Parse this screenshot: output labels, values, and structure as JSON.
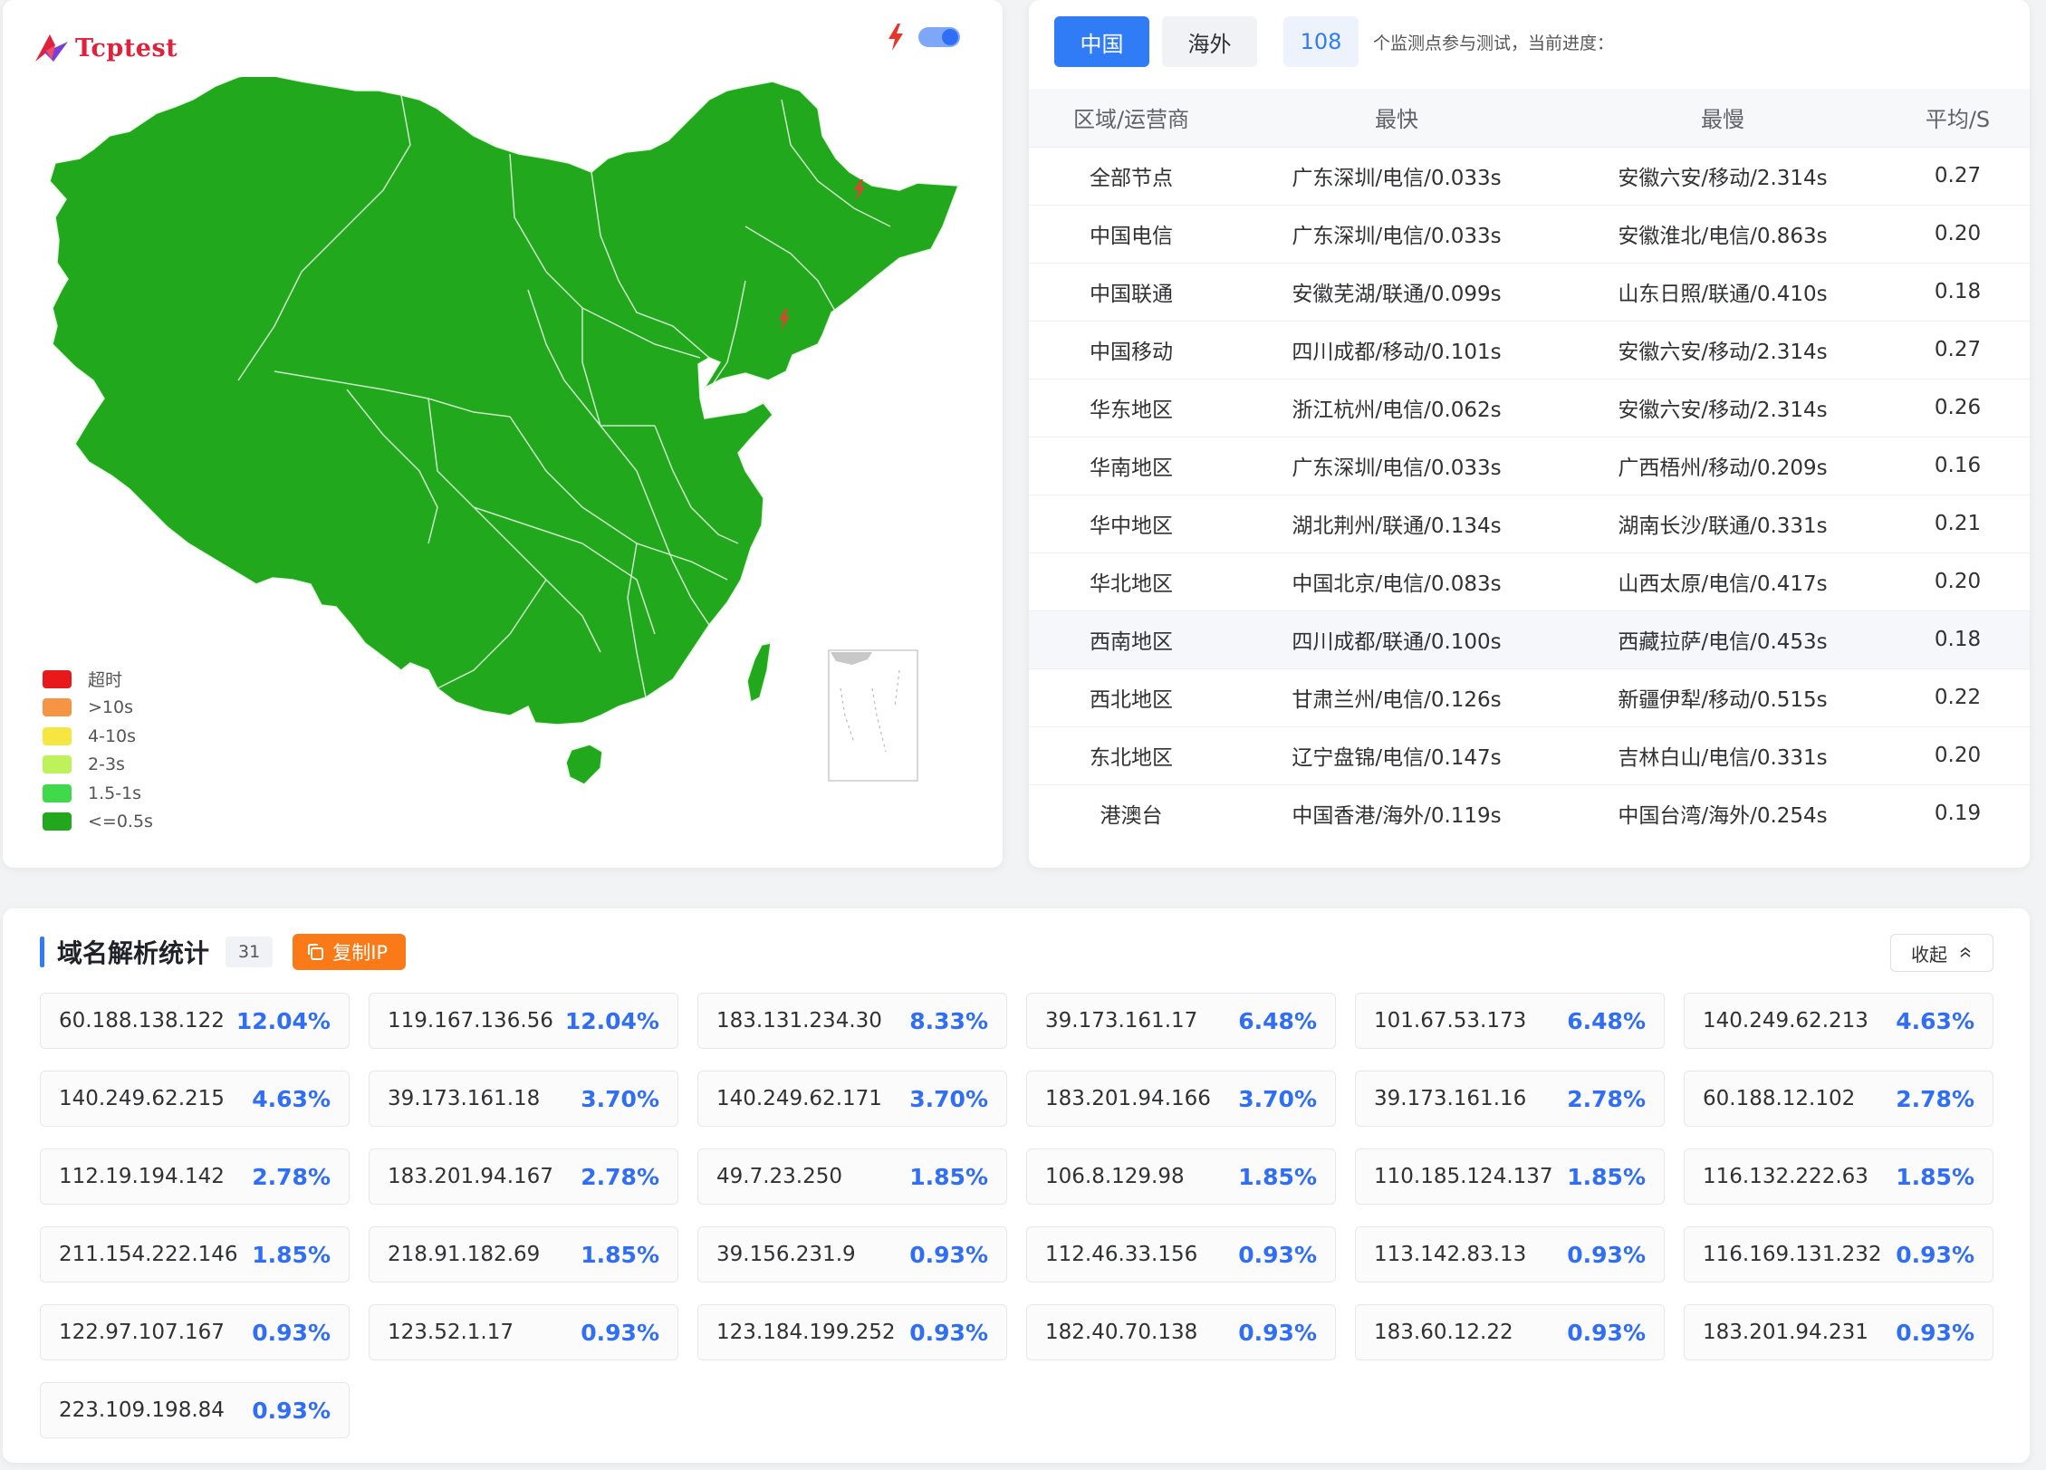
{
  "brand": {
    "name": "Tcptest"
  },
  "map": {
    "legend": [
      {
        "label": "超时",
        "color": "#e8191b"
      },
      {
        "label": ">10s",
        "color": "#f59442"
      },
      {
        "label": "4-10s",
        "color": "#f5e642"
      },
      {
        "label": "2-3s",
        "color": "#bdf25a"
      },
      {
        "label": "1.5-1s",
        "color": "#3fd94a"
      },
      {
        "label": "<=0.5s",
        "color": "#22a81c"
      }
    ],
    "fill_color": "#22a81c",
    "icons": [
      "lightning-icon",
      "toggle-switch"
    ]
  },
  "stats": {
    "tabs": [
      "中国",
      "海外"
    ],
    "active_tab": "中国",
    "node_count": "108",
    "progress_text": "个监测点参与测试，当前进度：",
    "headers": [
      "区域/运营商",
      "最快",
      "最慢",
      "平均/S"
    ],
    "rows": [
      [
        "全部节点",
        "广东深圳/电信/0.033s",
        "安徽六安/移动/2.314s",
        "0.27"
      ],
      [
        "中国电信",
        "广东深圳/电信/0.033s",
        "安徽淮北/电信/0.863s",
        "0.20"
      ],
      [
        "中国联通",
        "安徽芜湖/联通/0.099s",
        "山东日照/联通/0.410s",
        "0.18"
      ],
      [
        "中国移动",
        "四川成都/移动/0.101s",
        "安徽六安/移动/2.314s",
        "0.27"
      ],
      [
        "华东地区",
        "浙江杭州/电信/0.062s",
        "安徽六安/移动/2.314s",
        "0.26"
      ],
      [
        "华南地区",
        "广东深圳/电信/0.033s",
        "广西梧州/移动/0.209s",
        "0.16"
      ],
      [
        "华中地区",
        "湖北荆州/联通/0.134s",
        "湖南长沙/联通/0.331s",
        "0.21"
      ],
      [
        "华北地区",
        "中国北京/电信/0.083s",
        "山西太原/电信/0.417s",
        "0.20"
      ],
      [
        "西南地区",
        "四川成都/联通/0.100s",
        "西藏拉萨/电信/0.453s",
        "0.18"
      ],
      [
        "西北地区",
        "甘肃兰州/电信/0.126s",
        "新疆伊犁/移动/0.515s",
        "0.22"
      ],
      [
        "东北地区",
        "辽宁盘锦/电信/0.147s",
        "吉林白山/电信/0.331s",
        "0.20"
      ],
      [
        "港澳台",
        "中国香港/海外/0.119s",
        "中国台湾/海外/0.254s",
        "0.19"
      ]
    ]
  },
  "dns": {
    "title": "域名解析统计",
    "count": "31",
    "copy_label": "复制IP",
    "collapse_label": "收起",
    "ips": [
      [
        "60.188.138.122",
        "12.04%"
      ],
      [
        "119.167.136.56",
        "12.04%"
      ],
      [
        "183.131.234.30",
        "8.33%"
      ],
      [
        "39.173.161.17",
        "6.48%"
      ],
      [
        "101.67.53.173",
        "6.48%"
      ],
      [
        "140.249.62.213",
        "4.63%"
      ],
      [
        "140.249.62.215",
        "4.63%"
      ],
      [
        "39.173.161.18",
        "3.70%"
      ],
      [
        "140.249.62.171",
        "3.70%"
      ],
      [
        "183.201.94.166",
        "3.70%"
      ],
      [
        "39.173.161.16",
        "2.78%"
      ],
      [
        "60.188.12.102",
        "2.78%"
      ],
      [
        "112.19.194.142",
        "2.78%"
      ],
      [
        "183.201.94.167",
        "2.78%"
      ],
      [
        "49.7.23.250",
        "1.85%"
      ],
      [
        "106.8.129.98",
        "1.85%"
      ],
      [
        "110.185.124.137",
        "1.85%"
      ],
      [
        "116.132.222.63",
        "1.85%"
      ],
      [
        "211.154.222.146",
        "1.85%"
      ],
      [
        "218.91.182.69",
        "1.85%"
      ],
      [
        "39.156.231.9",
        "0.93%"
      ],
      [
        "112.46.33.156",
        "0.93%"
      ],
      [
        "113.142.83.13",
        "0.93%"
      ],
      [
        "116.169.131.232",
        "0.93%"
      ],
      [
        "122.97.107.167",
        "0.93%"
      ],
      [
        "123.52.1.17",
        "0.93%"
      ],
      [
        "123.184.199.252",
        "0.93%"
      ],
      [
        "182.40.70.138",
        "0.93%"
      ],
      [
        "183.60.12.22",
        "0.93%"
      ],
      [
        "183.201.94.231",
        "0.93%"
      ],
      [
        "223.109.198.84",
        "0.93%"
      ]
    ]
  }
}
